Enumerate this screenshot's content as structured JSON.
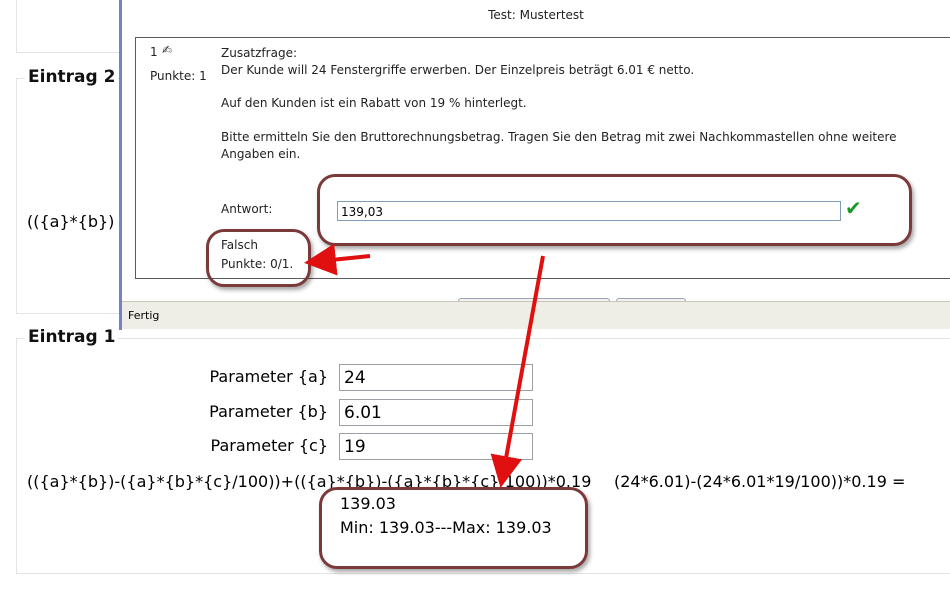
{
  "background": {
    "entry2": {
      "legend": "Eintrag 2",
      "formula_fragment": "(({a}*{b})"
    },
    "entry1": {
      "legend": "Eintrag 1",
      "params": [
        {
          "label": "Parameter {a}",
          "value": "24"
        },
        {
          "label": "Parameter {b}",
          "value": "6.01"
        },
        {
          "label": "Parameter {c}",
          "value": "19"
        }
      ],
      "formula_line": "(({a}*{b})-({a}*{b}*{c}/100))+(({a}*{b})-({a}*{b}*{c}/100))*0.19",
      "formula_eval_prefix": "(24*6.01)-(24*6.01*19/100))*0.19 =",
      "result": "139.03",
      "minmax": "Min: 139.03---Max: 139.03"
    }
  },
  "popup": {
    "title": "Test: Mustertest",
    "question": {
      "number": "1",
      "points_label": "Punkte: 1",
      "type_label": "Zusatzfrage:",
      "line1": "Der Kunde will 24 Fenstergriffe erwerben. Der Einzelpreis beträgt 6.01 € netto.",
      "line2": "Auf den Kunden ist ein Rabatt von 19 % hinterlegt.",
      "line3": "Bitte ermitteln Sie den Bruttorechnungsbetrag. Tragen Sie den Betrag mit zwei Nachkommastellen ohne weitere",
      "line4": "Angaben ein.",
      "answer_label": "Antwort:",
      "answer_value": "139,03",
      "result_label": "Falsch",
      "result_points": "Punkte: 0/1."
    },
    "status": "Fertig"
  },
  "colors": {
    "check": "#1a9a2a",
    "arrow": "#e01010",
    "callout": "#7a3a3a",
    "window_border": "#7383c8"
  }
}
